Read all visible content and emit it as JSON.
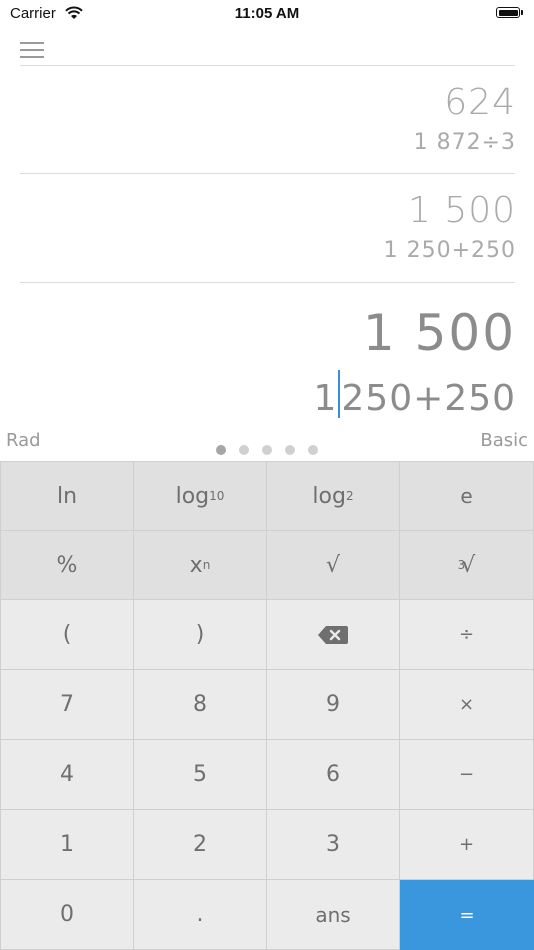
{
  "status_bar": {
    "carrier": "Carrier",
    "time": "11:05 AM"
  },
  "history": [
    {
      "result": "624",
      "expression": "1 872÷3"
    },
    {
      "result": "1 500",
      "expression": "1 250+250"
    }
  ],
  "current": {
    "result": "1 500",
    "expression_before_caret": "1",
    "expression_after_caret": "250+250"
  },
  "mode": {
    "angle": "Rad",
    "keyboard": "Basic"
  },
  "pager": {
    "count": 5,
    "active": 0
  },
  "keys": {
    "ln": "ln",
    "log10_base": "log",
    "log10_sub": "10",
    "log2_base": "log",
    "log2_sub": "2",
    "e": "e",
    "percent": "%",
    "power_base": "x",
    "power_sup": "n",
    "sqrt": "√",
    "cbrt_index": "3",
    "cbrt": "√",
    "lparen": "(",
    "rparen": ")",
    "divide": "÷",
    "seven": "7",
    "eight": "8",
    "nine": "9",
    "multiply": "×",
    "four": "4",
    "five": "5",
    "six": "6",
    "minus": "−",
    "one": "1",
    "two": "2",
    "three": "3",
    "plus": "+",
    "zero": "0",
    "decimal": ".",
    "ans": "ans",
    "equals": "="
  },
  "colors": {
    "accent": "#3a97dd",
    "key": "#ebebeb",
    "sci_key": "#e0e0e0",
    "divider": "#cfcfcf"
  },
  "icons": {
    "menu": "hamburger-icon",
    "backspace": "backspace-icon",
    "wifi": "wifi-icon",
    "battery": "battery-icon"
  }
}
